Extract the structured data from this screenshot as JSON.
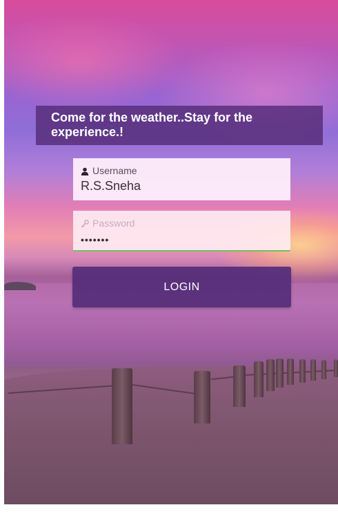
{
  "tagline": "Come for the weather..Stay for the experience.!",
  "username": {
    "icon": "user-icon",
    "label": "Username",
    "value": "R.S.Sneha"
  },
  "password": {
    "icon": "key-icon",
    "label": "Password",
    "masked_value": "•••••••"
  },
  "login_button": {
    "label": "LOGIN"
  },
  "colors": {
    "panel": "#562c78",
    "field_focus_underline": "#6cc26a"
  }
}
